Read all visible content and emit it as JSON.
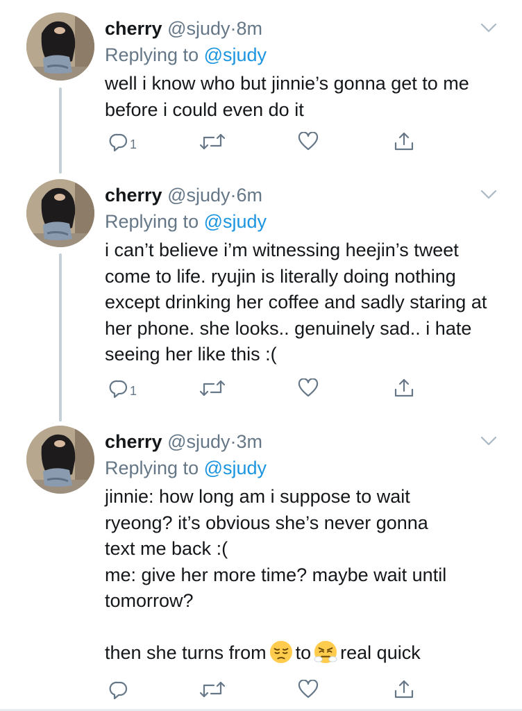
{
  "colors": {
    "name": "#14171a",
    "secondary": "#657786",
    "mention": "#1b95e0",
    "thread_line": "#c4cfd6",
    "icon": "#657786"
  },
  "tweets": [
    {
      "name": "cherry",
      "handle": "@sjudy",
      "dot": "·",
      "time": "8m",
      "replying_prefix": "Replying to",
      "replying_mention": "@sjudy",
      "text": "well i know who but jinnie’s gonna get to me before i could even do it",
      "reply_count": "1",
      "icons": [
        "reply-icon",
        "retweet-icon",
        "like-icon",
        "share-icon"
      ]
    },
    {
      "name": "cherry",
      "handle": "@sjudy",
      "dot": "·",
      "time": "6m",
      "replying_prefix": "Replying to",
      "replying_mention": "@sjudy",
      "text": "i can’t believe i’m witnessing heejin’s tweet come to life. ryujin is literally doing nothing except drinking her coffee and sadly staring at her phone. she looks.. genuinely sad.. i hate seeing her like this :(",
      "reply_count": "1",
      "icons": [
        "reply-icon",
        "retweet-icon",
        "like-icon",
        "share-icon"
      ]
    },
    {
      "name": "cherry",
      "handle": "@sjudy",
      "dot": "·",
      "time": "3m",
      "replying_prefix": "Replying to",
      "replying_mention": "@sjudy",
      "lines": [
        "jinnie: how long am i suppose to wait",
        "ryeong? it’s obvious she’s never gonna",
        "text me back :(",
        "me: give her more time? maybe wait until",
        "tomorrow?",
        "",
        "then she turns from"
      ],
      "emoji_1": "pensive-face",
      "word_between": "to",
      "emoji_2": "face-with-steam-from-nose",
      "text_end": "real quick",
      "reply_count": "",
      "icons": [
        "reply-icon",
        "retweet-icon",
        "like-icon",
        "share-icon"
      ]
    }
  ]
}
